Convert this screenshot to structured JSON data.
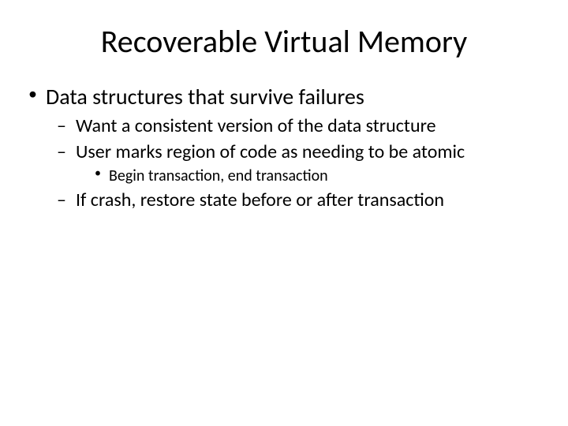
{
  "title": "Recoverable Virtual Memory",
  "bullets": {
    "l1_0": "Data structures that survive failures",
    "l2_0": "Want a consistent version of the data structure",
    "l2_1": "User marks region of code as needing to be atomic",
    "l3_0": "Begin transaction, end transaction",
    "l2_2": "If crash, restore state before or after transaction"
  }
}
